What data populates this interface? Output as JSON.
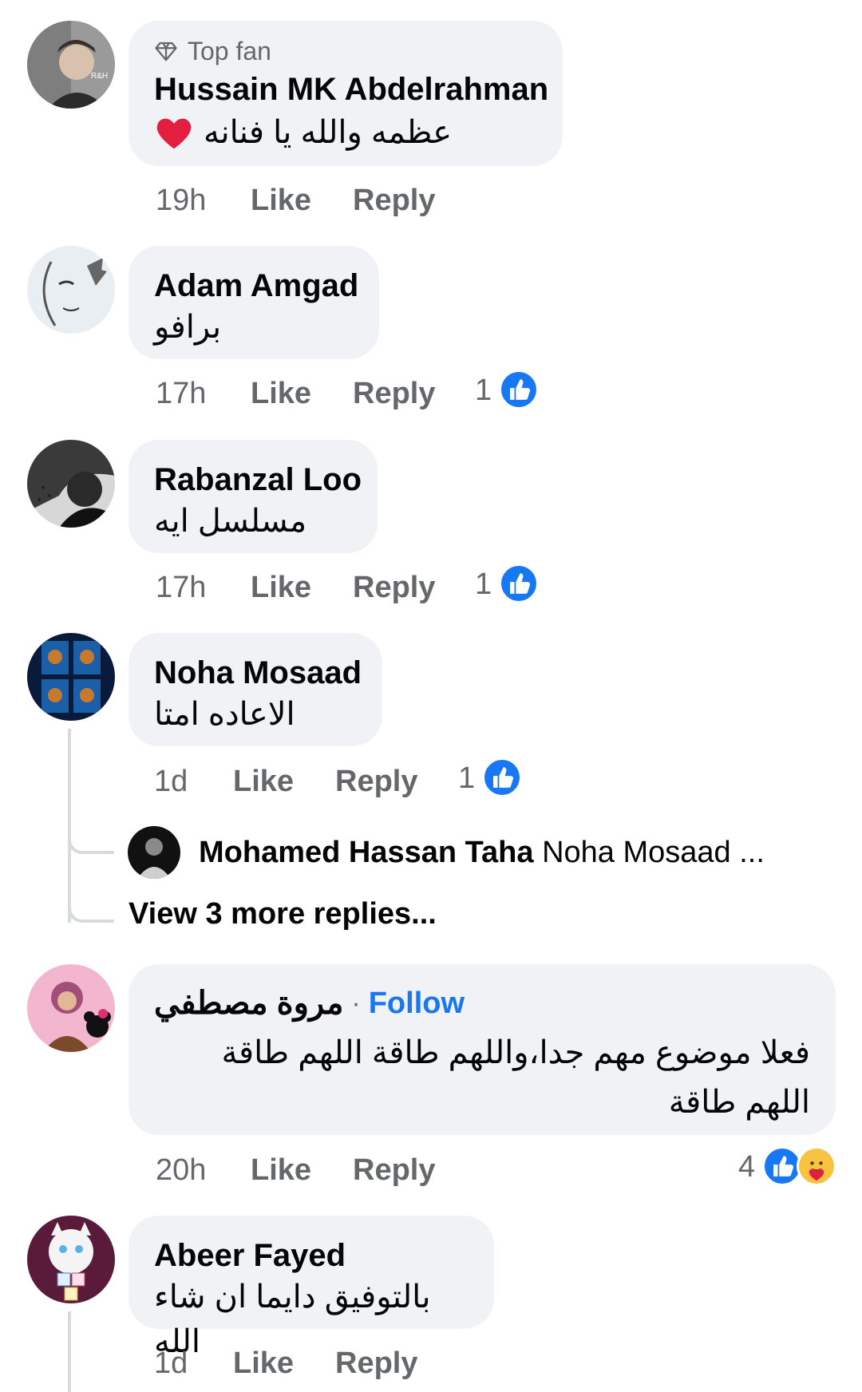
{
  "comments": [
    {
      "badge": "Top fan",
      "author": "Hussain MK Abdelrahman",
      "text": "عظمه والله يا فنانه",
      "time": "19h",
      "like": "Like",
      "reply": "Reply"
    },
    {
      "author": "Adam Amgad",
      "text": "برافو",
      "time": "17h",
      "like": "Like",
      "reply": "Reply",
      "reaction_count": "1"
    },
    {
      "author": "Rabanzal Loo",
      "text": "مسلسل ايه",
      "time": "17h",
      "like": "Like",
      "reply": "Reply",
      "reaction_count": "1"
    },
    {
      "author": "Noha Mosaad",
      "text": "الاعاده امتا",
      "time": "1d",
      "like": "Like",
      "reply": "Reply",
      "reaction_count": "1",
      "reply_preview": {
        "author": "Mohamed Hassan Taha",
        "text": "Noha Mosaad ..."
      },
      "view_more": "View 3 more replies..."
    },
    {
      "author": "مروة مصطفي",
      "separator": "·",
      "follow": "Follow",
      "text": "فعلا موضوع مهم جدا،واللهم طاقة اللهم طاقة اللهم طاقة",
      "time": "20h",
      "like": "Like",
      "reply": "Reply",
      "reaction_count": "4"
    },
    {
      "author": "Abeer Fayed",
      "text": "بالتوفيق دايما ان شاء الله",
      "time": "1d",
      "like": "Like",
      "reply": "Reply"
    }
  ],
  "colors": {
    "bubble": "#f0f2f5",
    "meta": "#65676b",
    "accent": "#1877f2",
    "heart": "#e41e3f"
  },
  "icons": [
    "top-fan-diamond-icon",
    "red-heart-emoji",
    "like-reaction-icon",
    "care-reaction-icon"
  ]
}
